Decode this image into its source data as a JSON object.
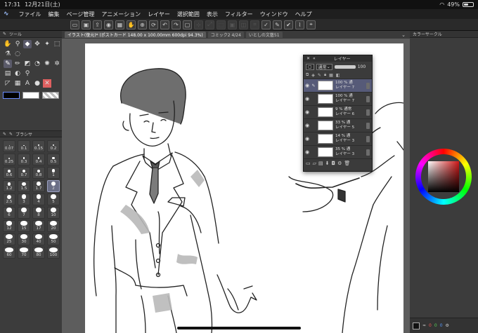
{
  "status": {
    "time": "17:31",
    "date": "12月21日(土)",
    "battery": "49%",
    "battery_level": 0.49
  },
  "menu": {
    "items": [
      "ファイル",
      "編集",
      "ページ管理",
      "アニメーション",
      "レイヤー",
      "選択範囲",
      "表示",
      "フィルター",
      "ウィンドウ",
      "ヘルプ"
    ]
  },
  "tabs": [
    {
      "label": "イラスト(復元)* (ポストカード 148.00 x 100.00mm 600dpi 94.3%)"
    },
    {
      "label": "コミック2 4/24"
    },
    {
      "label": "いとしの文藝51"
    }
  ],
  "tool_panel": {
    "title": "ツール"
  },
  "brush_panel": {
    "title": "ブラシサ",
    "sizes": [
      "0.07",
      "0.1",
      "0.15",
      "0.2",
      "0.25",
      "0.3",
      "0.4",
      "0.5",
      "0.6",
      "0.7",
      "0.8",
      "1",
      "1.2",
      "1.5",
      "1.7",
      "2",
      "2.5",
      "3",
      "4",
      "5",
      "6",
      "7",
      "8",
      "10",
      "12",
      "15",
      "17",
      "20",
      "25",
      "30",
      "40",
      "50",
      "60",
      "70",
      "80",
      "100"
    ],
    "selected": "2"
  },
  "layer_panel": {
    "title": "レイヤー",
    "blend_mode": "通常",
    "opacity": "100",
    "layers": [
      {
        "opacity": "100 %",
        "mode": "通",
        "name": "レイヤー 7",
        "selected": true
      },
      {
        "opacity": "100 %",
        "mode": "通",
        "name": "レイヤー 7"
      },
      {
        "opacity": "9 %",
        "mode": "通常",
        "name": "レイヤー 6"
      },
      {
        "opacity": "33 %",
        "mode": "通",
        "name": "レイヤー 5"
      },
      {
        "opacity": "14 %",
        "mode": "通",
        "name": "レイヤー 3"
      },
      {
        "opacity": "35 %",
        "mode": "通",
        "name": "レイヤー 3"
      }
    ]
  },
  "color_panel": {
    "title": "カラーサークル"
  },
  "color_footer": {
    "values": [
      "0",
      "0",
      "0"
    ]
  },
  "colors": {
    "accent": "#565a78",
    "main_color": "#000000"
  }
}
